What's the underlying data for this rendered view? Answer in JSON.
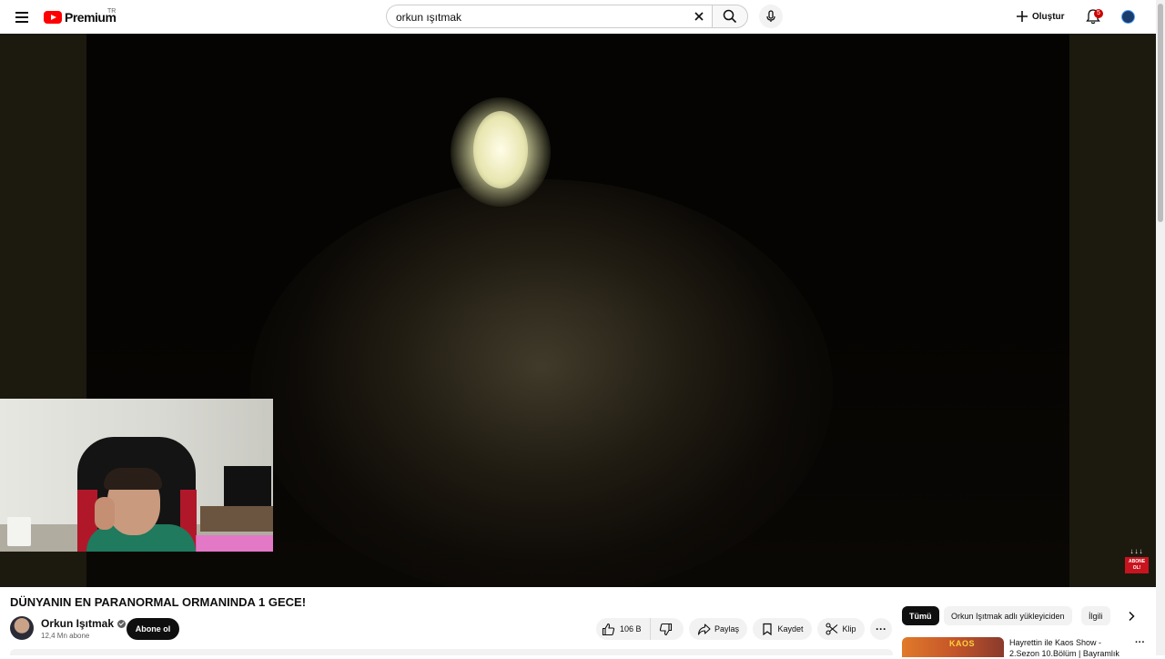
{
  "masthead": {
    "logo_text": "Premium",
    "country_code": "TR",
    "search_value": "orkun ışıtmak",
    "create_label": "Oluştur",
    "notification_count": "5"
  },
  "video": {
    "title": "DÜNYANIN EN PARANORMAL ORMANINDA 1 GECE!",
    "watermark_text": "ABONE OL!",
    "watermark_arrows": "↓↓↓"
  },
  "channel": {
    "name": "Orkun Işıtmak",
    "subscribers": "12,4 Mn abone",
    "subscribe_label": "Abone ol"
  },
  "actions": {
    "likes": "106 B",
    "share": "Paylaş",
    "save": "Kaydet",
    "clip": "Klip",
    "more": "···"
  },
  "sidebar": {
    "chips": [
      "Tümü",
      "Orkun Işıtmak adlı yükleyiciden",
      "İlgili"
    ],
    "recommendation": {
      "thumb_label": "KAOS",
      "title": "Hayrettin ile Kaos Show - 2.Sezon 10.Bölüm | Bayramlık",
      "more": "···"
    }
  },
  "colors": {
    "brand_red": "#ff0000",
    "accent_dark": "#0f0f0f",
    "chip_bg": "#f2f2f2"
  },
  "icons": [
    "menu-icon",
    "youtube-logo-icon",
    "close-icon",
    "search-icon",
    "mic-icon",
    "plus-icon",
    "bell-icon",
    "thumbs-up-icon",
    "thumbs-down-icon",
    "share-icon",
    "bookmark-icon",
    "scissors-icon",
    "chevron-right-icon"
  ]
}
